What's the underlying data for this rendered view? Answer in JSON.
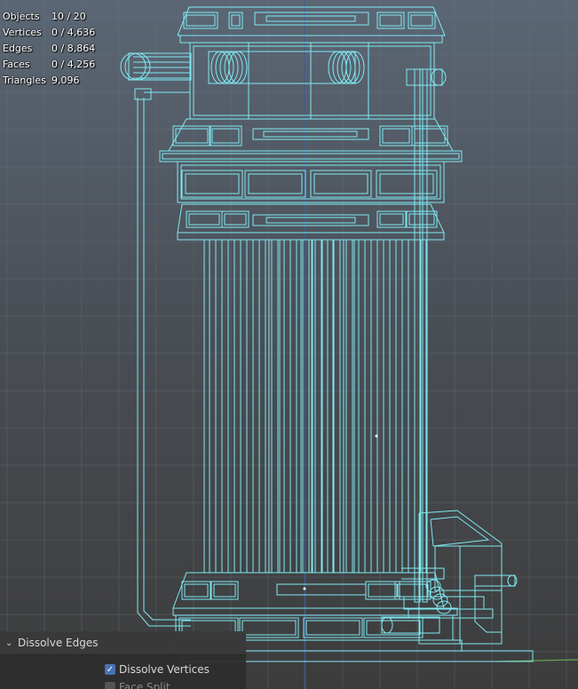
{
  "viewport": {
    "wire_color": "#7fe9f2",
    "background_top": "#5b6775",
    "background_bottom": "#3c3c3c"
  },
  "stats": [
    {
      "label": "Objects",
      "value": "10 / 20"
    },
    {
      "label": "Vertices",
      "value": "0 / 4,636"
    },
    {
      "label": "Edges",
      "value": "0 / 8,864"
    },
    {
      "label": "Faces",
      "value": "0 / 4,256"
    },
    {
      "label": "Triangles",
      "value": "9,096"
    }
  ],
  "operator_panel": {
    "title": "Dissolve Edges",
    "collapse_icon": "chevron-down-icon",
    "options": [
      {
        "label": "Dissolve Vertices",
        "checked": true
      },
      {
        "label": "Face Split",
        "checked": false
      }
    ]
  }
}
